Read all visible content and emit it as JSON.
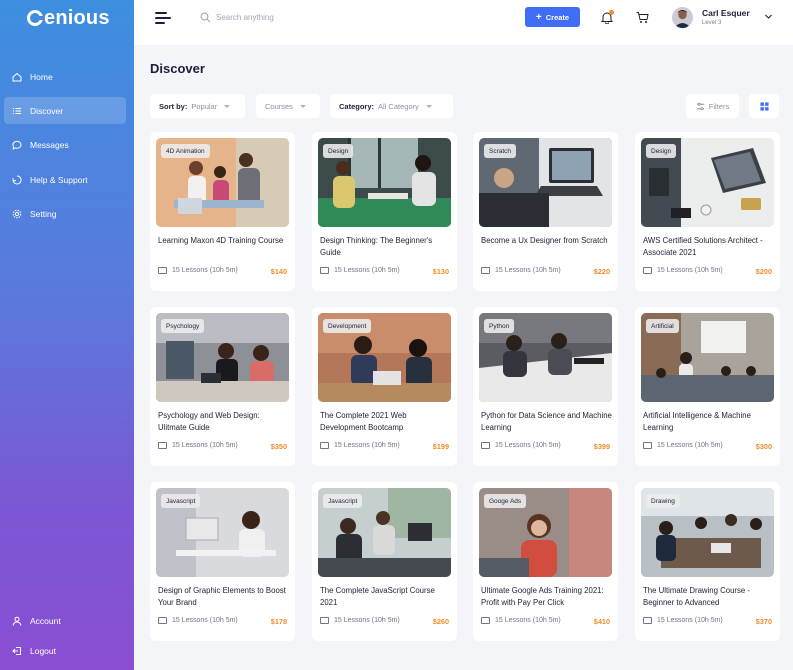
{
  "app": {
    "logo": "enious"
  },
  "sidebar": {
    "items": [
      {
        "label": "Home",
        "icon": "home-icon"
      },
      {
        "label": "Discover",
        "icon": "list-icon",
        "active": true
      },
      {
        "label": "Messages",
        "icon": "message-icon"
      },
      {
        "label": "Help & Support",
        "icon": "support-icon"
      },
      {
        "label": "Setting",
        "icon": "gear-icon"
      }
    ],
    "bottom": [
      {
        "label": "Account",
        "icon": "user-icon"
      },
      {
        "label": "Logout",
        "icon": "logout-icon"
      }
    ]
  },
  "header": {
    "search_placeholder": "Search anything",
    "create_label": "Create",
    "user_name": "Carl Esquer",
    "user_level": "Level 3"
  },
  "main": {
    "title": "Discover",
    "sort_label": "Sort by:",
    "sort_value": "Popular",
    "type_value": "Courses",
    "category_label": "Category:",
    "category_value": "All Category",
    "filters_label": "Filters"
  },
  "courses": [
    {
      "tag": "4D Animation",
      "title": "Learning Maxon 4D Training Course",
      "lessons": "15 Lessons (10h 5m)",
      "price": "$140"
    },
    {
      "tag": "Design",
      "title": "Design Thinking: The Beginner's Guide",
      "lessons": "15 Lessons (10h 5m)",
      "price": "$130"
    },
    {
      "tag": "Scratch",
      "title": "Become a Ux Designer from Scratch",
      "lessons": "15 Lessons (10h 5m)",
      "price": "$220"
    },
    {
      "tag": "Design",
      "title": "AWS Certified Solutions Architect - Associate 2021",
      "lessons": "15 Lessons (10h 5m)",
      "price": "$200"
    },
    {
      "tag": "Psychology",
      "title": "Psychology and Web Design: Ulitmate Guide",
      "lessons": "15 Lessons (10h 5m)",
      "price": "$350"
    },
    {
      "tag": "Development",
      "title": "The Complete 2021 Web Development Bootcamp",
      "lessons": "15 Lessons (10h 5m)",
      "price": "$199"
    },
    {
      "tag": "Python",
      "title": "Python for Data Science and Machine Learning",
      "lessons": "15 Lessons (10h 5m)",
      "price": "$399"
    },
    {
      "tag": "Artificial",
      "title": "Artificial Intelligence & Machine Learning",
      "lessons": "15 Lessons (10h 5m)",
      "price": "$300"
    },
    {
      "tag": "Javascript",
      "title": "Design of Graphic Elements to Boost Your Brand",
      "lessons": "15 Lessons (10h 5m)",
      "price": "$178"
    },
    {
      "tag": "Javascript",
      "title": "The Complete JavaScript Course 2021",
      "lessons": "15 Lessons (10h 5m)",
      "price": "$260"
    },
    {
      "tag": "Googe Ads",
      "title": "Ultimate Google Ads Training 2021: Profit with Pay Per Click",
      "lessons": "15 Lessons (10h 5m)",
      "price": "$410"
    },
    {
      "tag": "Drawing",
      "title": "The Ultimate Drawing Course - Beginner to Advanced",
      "lessons": "15 Lessons (10h 5m)",
      "price": "$370"
    }
  ]
}
